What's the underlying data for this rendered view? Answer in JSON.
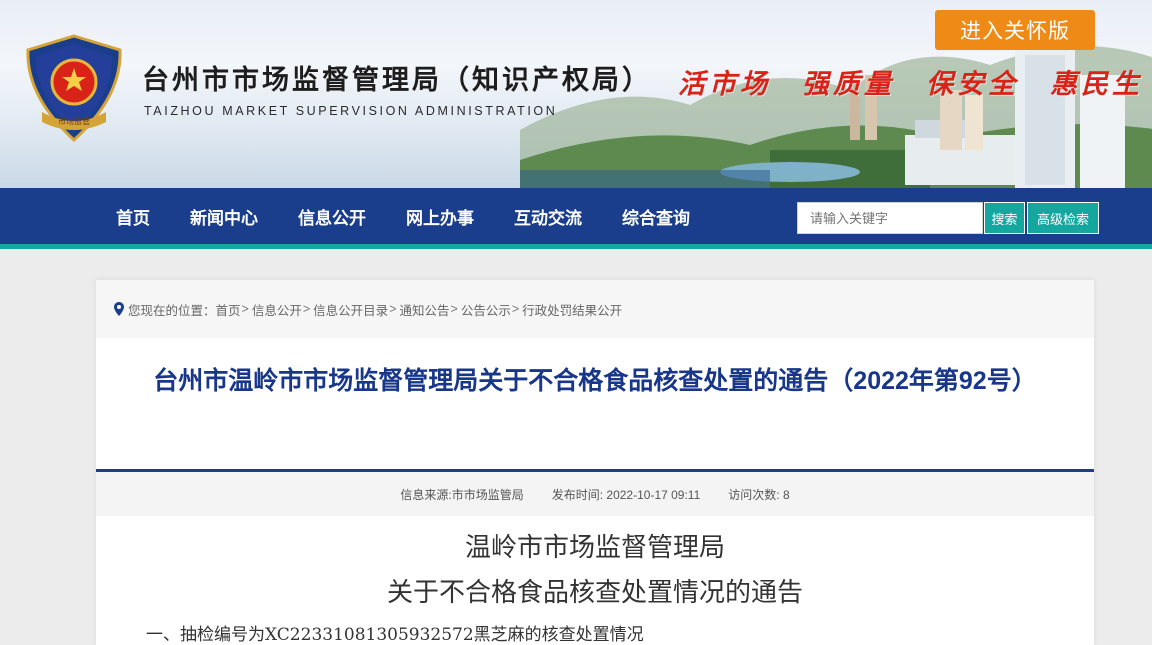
{
  "header": {
    "title": "台州市市场监督管理局（知识产权局）",
    "subtitle": "TAIZHOU MARKET SUPERVISION ADMINISTRATION",
    "slogan": "活市场　强质量　保安全　惠民生",
    "care_button": "进入关怀版",
    "emblem_text": "市场监管",
    "slogan_color": "#d92318"
  },
  "nav": {
    "items": [
      "首页",
      "新闻中心",
      "信息公开",
      "网上办事",
      "互动交流",
      "综合查询"
    ],
    "search_placeholder": "请输入关键字",
    "search_button": "搜索",
    "advanced_button": "高级检索",
    "bar_color": "#1a3d8c",
    "accent_color": "#16a6a0"
  },
  "breadcrumb": {
    "prefix": "您现在的位置：",
    "items": [
      "首页",
      "信息公开",
      "信息公开目录",
      "通知公告",
      "公告公示",
      "行政处罚结果公开"
    ],
    "separator": ">"
  },
  "article": {
    "headline": "台州市温岭市市场监督管理局关于不合格食品核查处置的通告（2022年第92号）",
    "source_label": "信息来源:",
    "source": "市市场监管局",
    "date_label": "发布时间:",
    "date": "2022-10-17 09:11",
    "views_label": "访问次数:",
    "views": "8",
    "doc_title_1": "温岭市市场监督管理局",
    "doc_title_2": "关于不合格食品核查处置情况的通告",
    "first_paragraph": "一、抽检编号为XC22331081305932572黑芝麻的核查处置情况"
  }
}
